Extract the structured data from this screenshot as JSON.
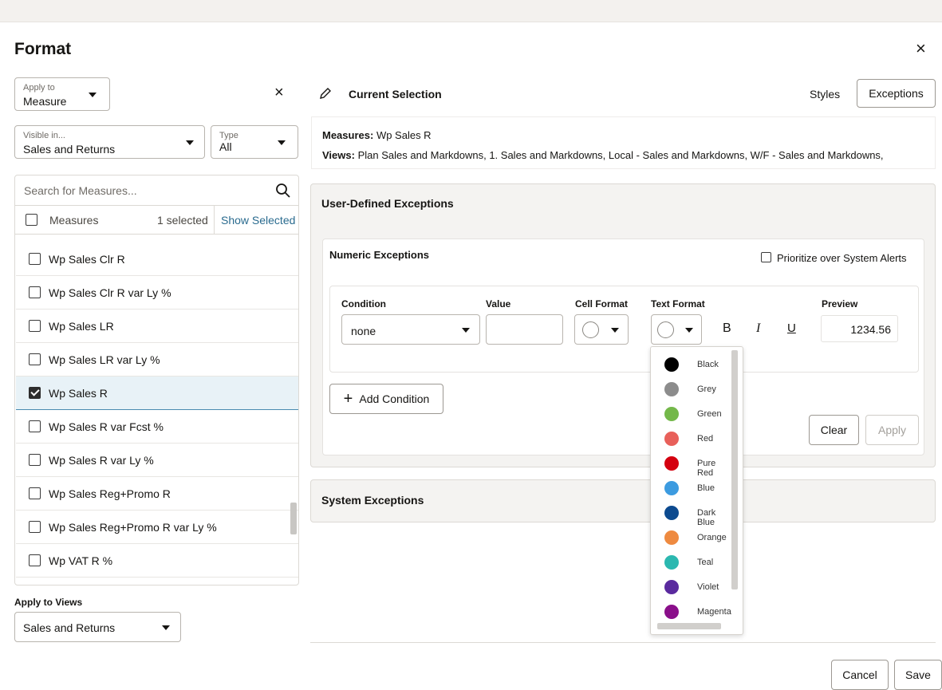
{
  "dialog": {
    "title": "Format"
  },
  "apply_to": {
    "label": "Apply to",
    "value": "Measure"
  },
  "visible_in": {
    "label": "Visible in...",
    "value": "Sales and Returns"
  },
  "type": {
    "label": "Type",
    "value": "All"
  },
  "search": {
    "placeholder": "Search for Measures..."
  },
  "measures": {
    "header": "Measures",
    "selected_count": "1 selected",
    "show_selected": "Show Selected",
    "items": [
      {
        "label": "Wp Sales Clr R",
        "checked": false
      },
      {
        "label": "Wp Sales Clr R var Ly %",
        "checked": false
      },
      {
        "label": "Wp Sales LR",
        "checked": false
      },
      {
        "label": "Wp Sales LR var Ly %",
        "checked": false
      },
      {
        "label": "Wp Sales R",
        "checked": true
      },
      {
        "label": "Wp Sales R var Fcst %",
        "checked": false
      },
      {
        "label": "Wp Sales R var Ly %",
        "checked": false
      },
      {
        "label": "Wp Sales Reg+Promo R",
        "checked": false
      },
      {
        "label": "Wp Sales Reg+Promo R var Ly %",
        "checked": false
      },
      {
        "label": "Wp VAT R %",
        "checked": false
      }
    ]
  },
  "apply_to_views": {
    "label": "Apply to Views",
    "value": "Sales and Returns"
  },
  "current_selection": {
    "label": "Current Selection",
    "styles_label": "Styles",
    "exceptions_label": "Exceptions",
    "measures_key": "Measures:",
    "measures_value": "Wp Sales R",
    "views_key": "Views:",
    "views_value": "Plan Sales and Markdowns, 1. Sales and Markdowns, Local - Sales and Markdowns, W/F - Sales and Markdowns,"
  },
  "user_defined": {
    "title": "User-Defined Exceptions",
    "numeric_title": "Numeric Exceptions",
    "prioritize_label": "Prioritize over System Alerts",
    "condition_header": "Condition",
    "condition_value": "none",
    "value_header": "Value",
    "cell_format_header": "Cell Format",
    "text_format_header": "Text Format",
    "preview_header": "Preview",
    "preview_value": "1234.56",
    "bold_label": "B",
    "italic_label": "I",
    "underline_label": "U",
    "add_condition_label": "Add Condition",
    "clear_label": "Clear",
    "apply_label": "Apply"
  },
  "system_exceptions": {
    "title": "System Exceptions"
  },
  "color_options": [
    {
      "name": "Black",
      "color": "#000000"
    },
    {
      "name": "Grey",
      "color": "#8c8c8c"
    },
    {
      "name": "Green",
      "color": "#74b84a"
    },
    {
      "name": "Red",
      "color": "#e8605a"
    },
    {
      "name": "Pure Red",
      "color": "#d4000f"
    },
    {
      "name": "Blue",
      "color": "#3c9be0"
    },
    {
      "name": "Dark Blue",
      "color": "#0c4a8f"
    },
    {
      "name": "Orange",
      "color": "#ee8a40"
    },
    {
      "name": "Teal",
      "color": "#2bb8b0"
    },
    {
      "name": "Violet",
      "color": "#5a2a9e"
    },
    {
      "name": "Magenta",
      "color": "#8a0f8a"
    }
  ],
  "footer": {
    "cancel_label": "Cancel",
    "save_label": "Save"
  }
}
